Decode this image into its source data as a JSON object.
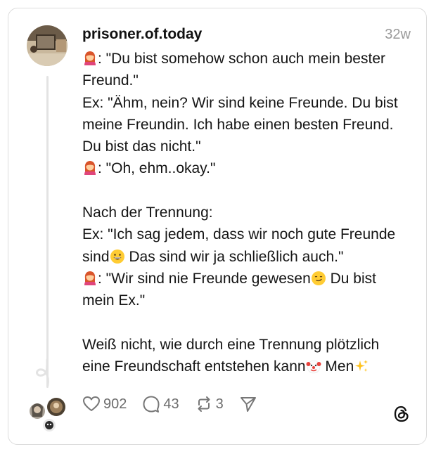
{
  "post": {
    "username": "prisoner.of.today",
    "time": "32w",
    "lines": [
      [
        {
          "emoji": "woman-red-hair"
        },
        {
          "t": ": \"Du bist somehow schon auch mein bester"
        }
      ],
      [
        {
          "t": "Freund.\""
        }
      ],
      [
        {
          "t": "Ex: \"Ähm, nein? Wir sind keine Freunde. Du bist"
        }
      ],
      [
        {
          "t": "meine Freundin. Ich habe einen besten Freund."
        }
      ],
      [
        {
          "t": "Du bist das nicht.\""
        }
      ],
      [
        {
          "emoji": "woman-red-hair"
        },
        {
          "t": ": \"Oh, ehm..okay.\""
        }
      ],
      [],
      [
        {
          "t": "Nach der Trennung:"
        }
      ],
      [
        {
          "t": "Ex: \"Ich sag jedem, dass wir noch gute Freunde"
        }
      ],
      [
        {
          "t": "sind"
        },
        {
          "emoji": "grinning-face"
        },
        {
          "t": " Das sind wir ja schließlich auch.\""
        }
      ],
      [
        {
          "emoji": "woman-red-hair"
        },
        {
          "t": ": \"Wir sind nie Freunde gewesen"
        },
        {
          "emoji": "smirking-face"
        },
        {
          "t": " Du bist"
        }
      ],
      [
        {
          "t": "mein Ex.\""
        }
      ],
      [],
      [
        {
          "t": "Weiß nicht, wie durch eine Trennung plötzlich"
        }
      ],
      [
        {
          "t": "eine Freundschaft entstehen kann"
        },
        {
          "emoji": "clown-face"
        },
        {
          "t": " Men"
        },
        {
          "emoji": "sparkles"
        }
      ]
    ]
  },
  "actions": {
    "likes": "902",
    "comments": "43",
    "reposts": "3"
  },
  "icons": [
    "heart-icon",
    "comment-icon",
    "repost-icon",
    "share-icon",
    "threads-logo-icon"
  ]
}
